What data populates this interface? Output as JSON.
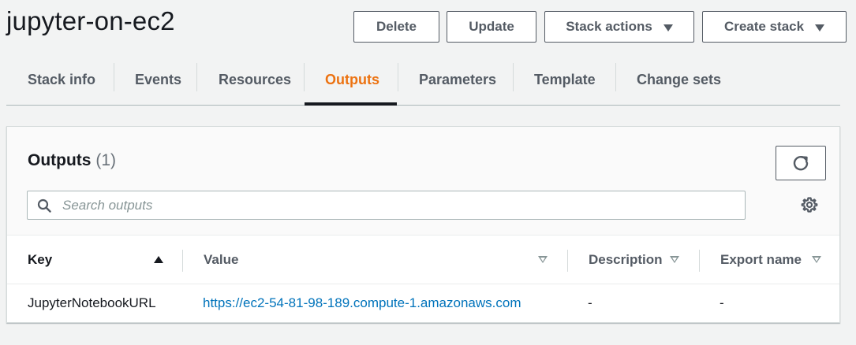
{
  "stack": {
    "name": "jupyter-on-ec2"
  },
  "actions": {
    "delete_label": "Delete",
    "update_label": "Update",
    "stack_actions_label": "Stack actions",
    "create_stack_label": "Create stack"
  },
  "tabs": [
    {
      "label": "Stack info"
    },
    {
      "label": "Events"
    },
    {
      "label": "Resources"
    },
    {
      "label": "Outputs",
      "active": true
    },
    {
      "label": "Parameters"
    },
    {
      "label": "Template"
    },
    {
      "label": "Change sets"
    }
  ],
  "outputs": {
    "title": "Outputs",
    "count": "(1)",
    "search_placeholder": "Search outputs",
    "columns": {
      "key": "Key",
      "value": "Value",
      "description": "Description",
      "export_name": "Export name"
    },
    "rows": [
      {
        "key": "JupyterNotebookURL",
        "value": "https://ec2-54-81-98-189.compute-1.amazonaws.com",
        "description": "-",
        "export_name": "-"
      }
    ]
  },
  "colors": {
    "accent": "#ec7211",
    "link": "#0073bb",
    "text": "#16191f",
    "muted": "#545b64"
  },
  "icons": [
    "caret-down-icon",
    "refresh-icon",
    "search-icon",
    "gear-icon",
    "sort-ascending-icon",
    "sort-icon"
  ]
}
